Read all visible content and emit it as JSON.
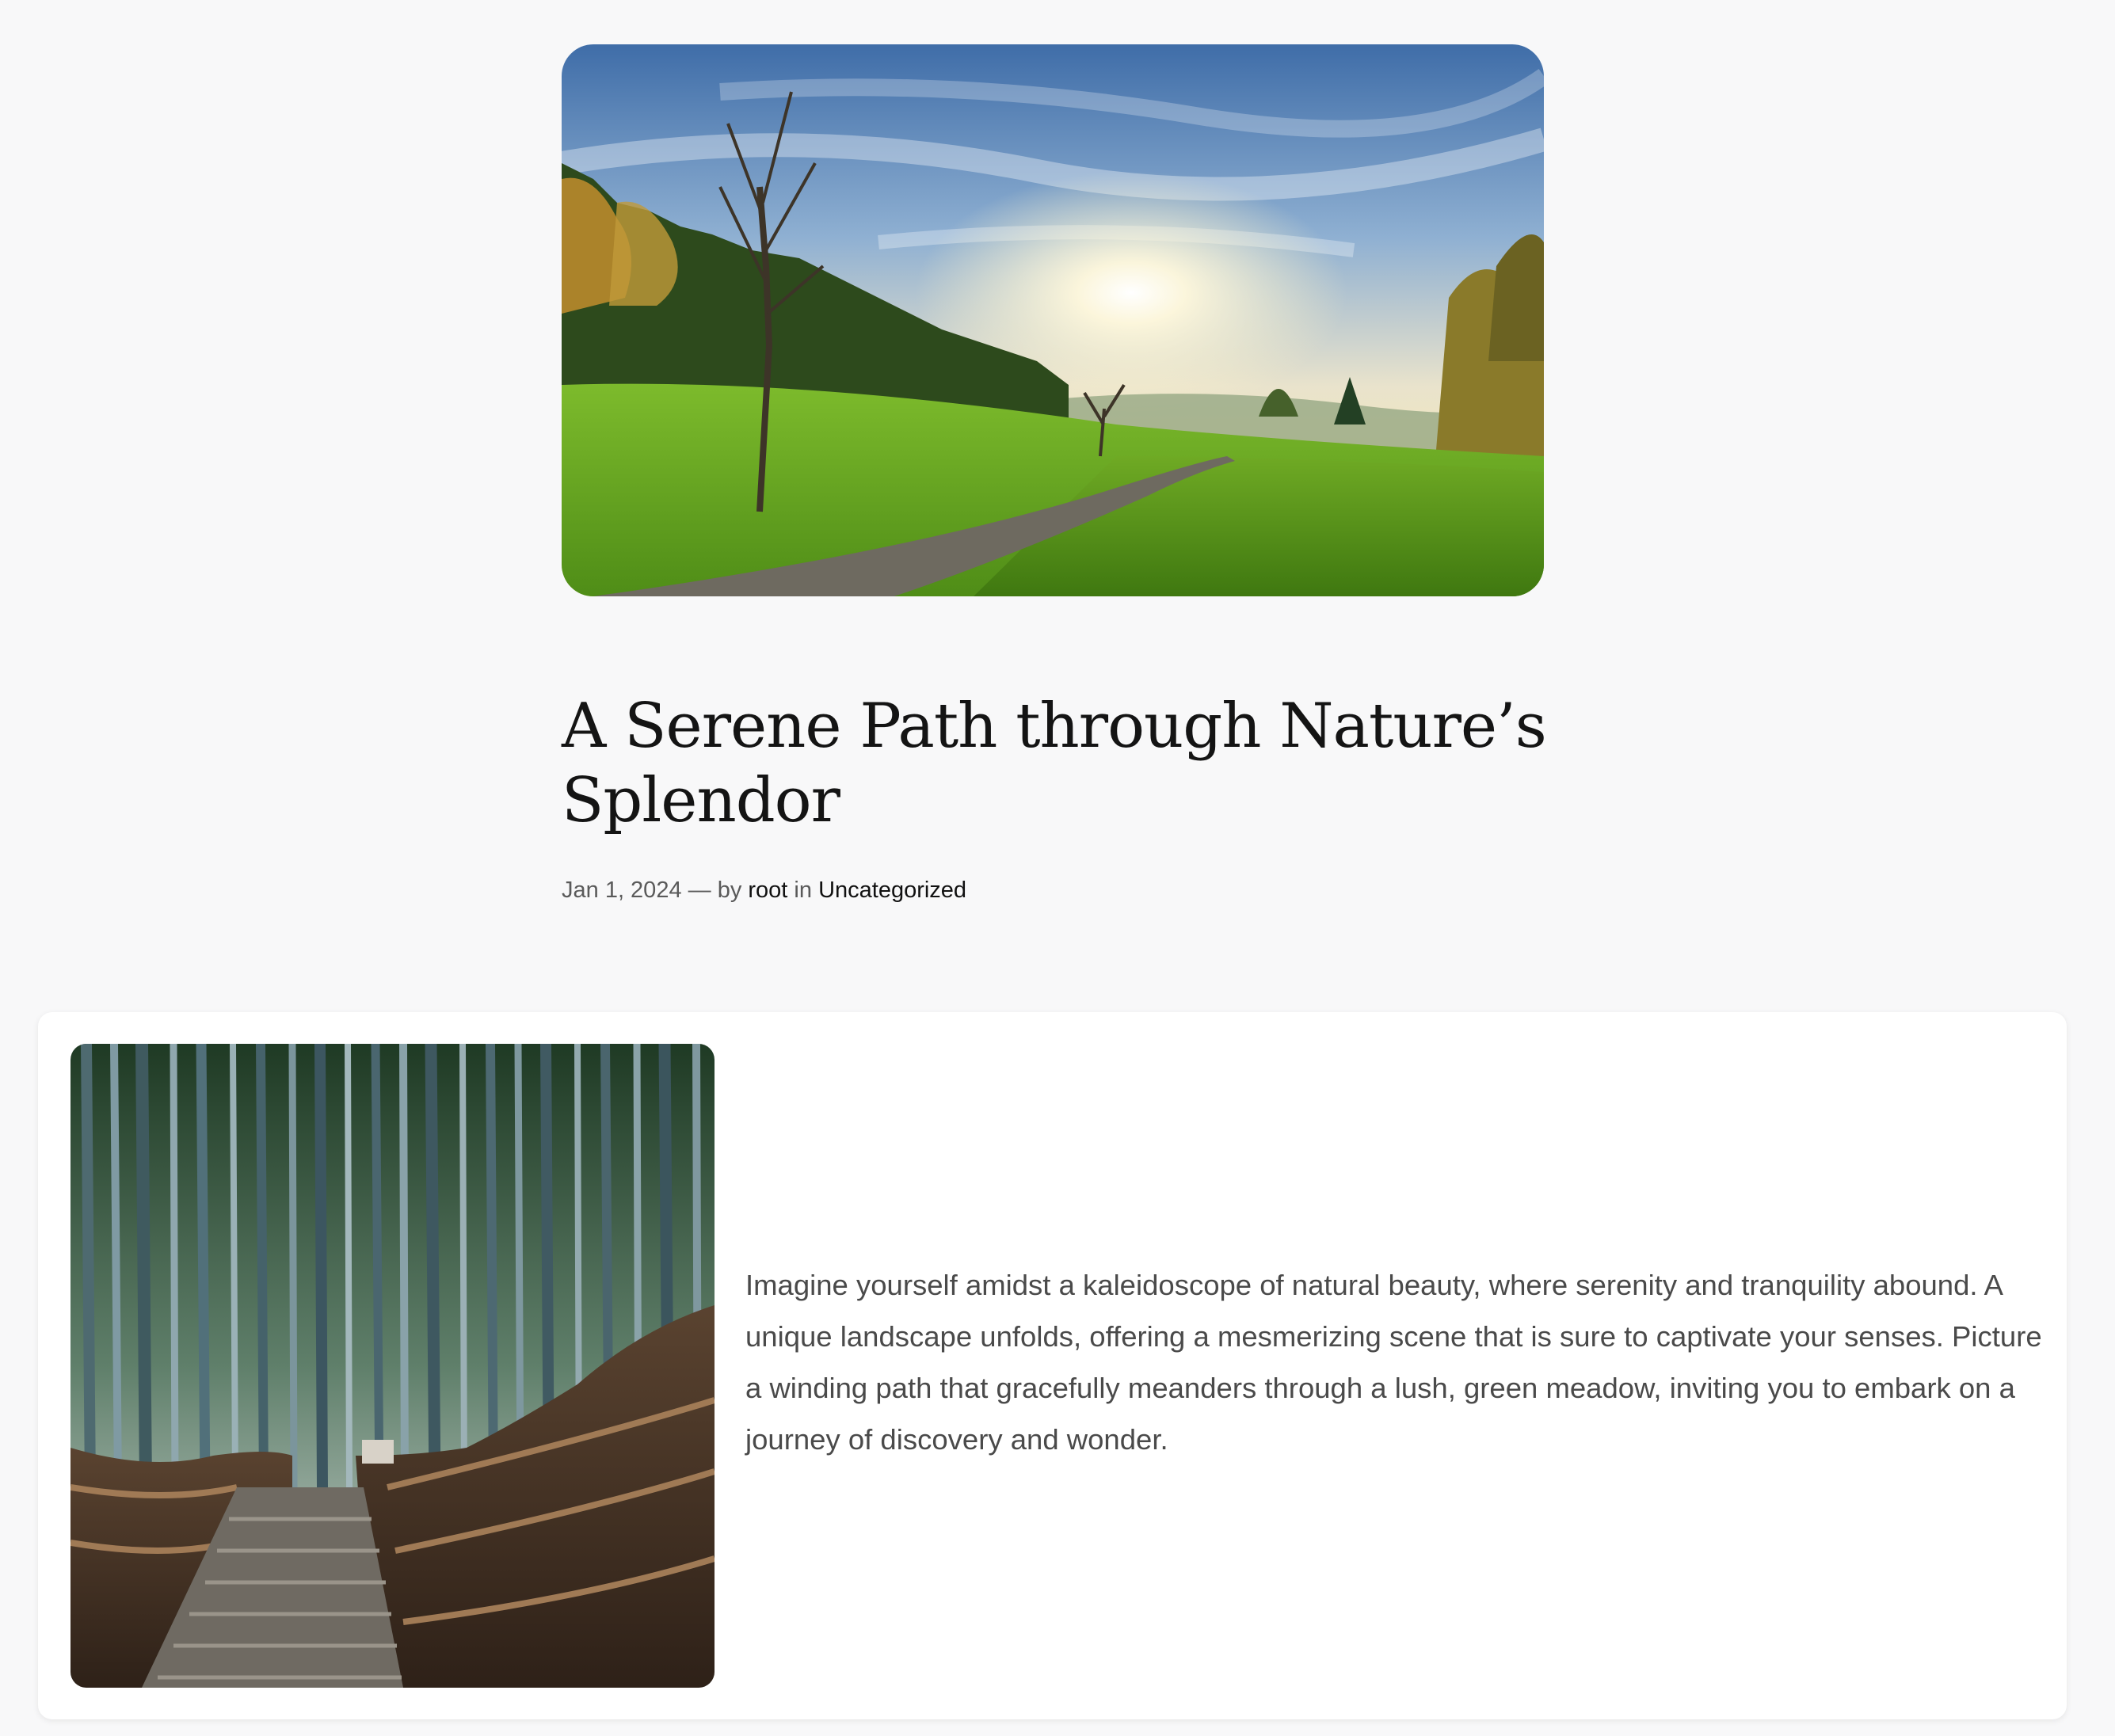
{
  "post": {
    "title": "A Serene Path through Nature’s Splendor",
    "date": "Jan 1, 2024",
    "dash": " — ",
    "by": "by ",
    "author": "root",
    "in": " in ",
    "category": "Uncategorized"
  },
  "hero_image": {
    "subject": "meadow-path-landscape"
  },
  "card": {
    "image_subject": "bamboo-forest-stairs",
    "text": "Imagine yourself amidst a kaleidoscope of natural beauty, where serenity and tranquility abound. A unique landscape unfolds, offering a mesmerizing scene that is sure to captivate your senses. Picture a winding path that gracefully meanders through a lush, green meadow, inviting you to embark on a journey of discovery and wonder."
  },
  "colors": {
    "background": "#f8f8f9",
    "title": "#141414",
    "meta": "#5a5a5a",
    "link": "#111111",
    "body_text": "#4a4a4a",
    "card": "#ffffff"
  }
}
